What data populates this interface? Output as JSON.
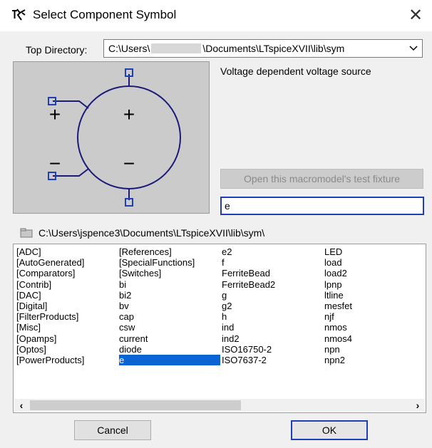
{
  "window": {
    "title": "Select Component Symbol",
    "close_glyph": "✕"
  },
  "top_directory": {
    "label": "Top Directory:",
    "value_prefix": "C:\\Users\\",
    "value_suffix": "\\Documents\\LTspiceXVII\\lib\\sym"
  },
  "symbol": {
    "description": "Voltage dependent voltage source",
    "test_fixture_label": "Open this macromodel's test fixture",
    "plus_sign": "+",
    "minus_sign": "−"
  },
  "search": {
    "value": "e"
  },
  "current_path": "C:\\Users\\jspence3\\Documents\\LTspiceXVII\\lib\\sym\\",
  "list": {
    "columns": [
      [
        "[ADC]",
        "[AutoGenerated]",
        "[Comparators]",
        "[Contrib]",
        "[DAC]",
        "[Digital]",
        "[FilterProducts]",
        "[Misc]",
        "[Opamps]",
        "[Optos]",
        "[PowerProducts]"
      ],
      [
        "[References]",
        "[SpecialFunctions]",
        "[Switches]",
        "bi",
        "bi2",
        "bv",
        "cap",
        "csw",
        "current",
        "diode",
        "e"
      ],
      [
        "e2",
        "f",
        "FerriteBead",
        "FerriteBead2",
        "g",
        "g2",
        "h",
        "ind",
        "ind2",
        "ISO16750-2",
        "ISO7637-2"
      ],
      [
        "LED",
        "load",
        "load2",
        "lpnp",
        "ltline",
        "mesfet",
        "njf",
        "nmos",
        "nmos4",
        "npn",
        "npn2"
      ]
    ],
    "selected": "e"
  },
  "buttons": {
    "cancel": "Cancel",
    "ok": "OK"
  },
  "icons": {
    "title": "ltspice-component-icon",
    "dropdown": "chevron-down-icon",
    "folder": "folder-icon",
    "scroll_left": "chevron-left-icon",
    "scroll_right": "chevron-right-icon"
  },
  "colors": {
    "selection": "#0a64d4",
    "symbol_stroke": "#1a1a7a",
    "pin": "#1f3fb5",
    "focus_border": "#1f3fb5"
  }
}
